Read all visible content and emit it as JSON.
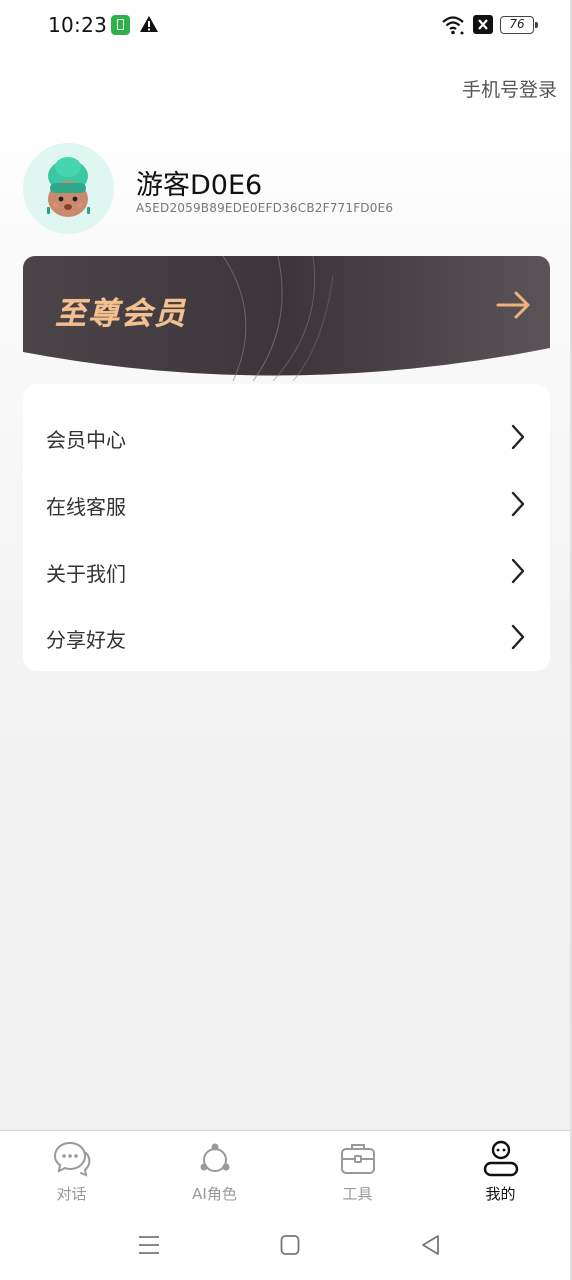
{
  "status_bar": {
    "time": "10:23",
    "battery": "76"
  },
  "header": {
    "phone_login_label": "手机号登录"
  },
  "profile": {
    "username": "游客D0E6",
    "user_id": "A5ED2059B89EDE0EFD36CB2F771FD0E6"
  },
  "vip": {
    "title": "至尊会员"
  },
  "menu": {
    "items": [
      {
        "label": "会员中心"
      },
      {
        "label": "在线客服"
      },
      {
        "label": "关于我们"
      },
      {
        "label": "分享好友"
      }
    ]
  },
  "tabs": [
    {
      "label": "对话",
      "icon": "chat-bubble-icon",
      "active": false
    },
    {
      "label": "AI角色",
      "icon": "ai-role-icon",
      "active": false
    },
    {
      "label": "工具",
      "icon": "toolbox-icon",
      "active": false
    },
    {
      "label": "我的",
      "icon": "profile-icon",
      "active": true
    }
  ],
  "colors": {
    "vip_gold": "#f4c08f",
    "vip_dark": "#3f3a3f",
    "avatar_bg": "#dff7f0",
    "active_tab": "#111111",
    "inactive_tab": "#999999"
  }
}
